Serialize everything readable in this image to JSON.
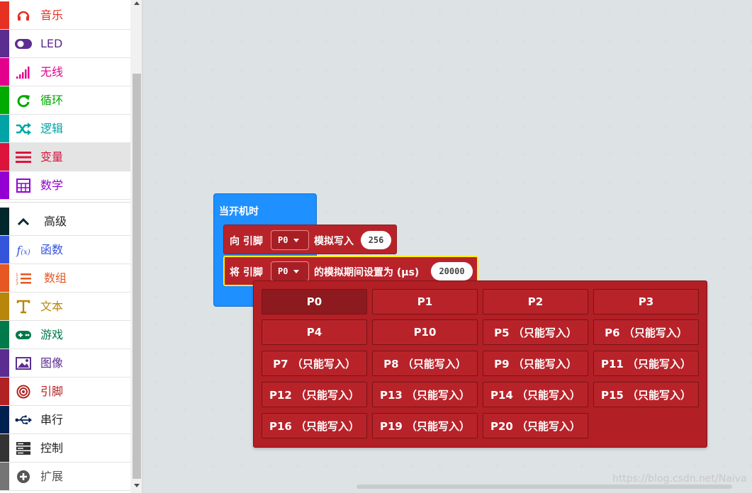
{
  "toolbox": {
    "categories_top": [
      {
        "label": "音乐",
        "icon": "headphones-icon",
        "color": "#e63022"
      },
      {
        "label": "LED",
        "icon": "toggle-icon",
        "color": "#5c2d91"
      },
      {
        "label": "无线",
        "icon": "signal-bars-icon",
        "color": "#e3008c"
      },
      {
        "label": "循环",
        "icon": "refresh-icon",
        "color": "#00aa00"
      },
      {
        "label": "逻辑",
        "icon": "shuffle-icon",
        "color": "#00a4a6"
      },
      {
        "label": "变量",
        "icon": "list-icon",
        "color": "#dc143c"
      },
      {
        "label": "数学",
        "icon": "calculator-icon",
        "color": "#9400d3"
      }
    ],
    "categories_bottom": [
      {
        "label": "高级",
        "icon": "chevron-up-icon",
        "color": "#00272b"
      },
      {
        "label": "函数",
        "icon": "function-icon",
        "color": "#3455db"
      },
      {
        "label": "数组",
        "icon": "numbered-list-icon",
        "color": "#e65722"
      },
      {
        "label": "文本",
        "icon": "text-icon",
        "color": "#b8860b"
      },
      {
        "label": "游戏",
        "icon": "gamepad-icon",
        "color": "#007a4b"
      },
      {
        "label": "图像",
        "icon": "image-icon",
        "color": "#5c2d91"
      },
      {
        "label": "引脚",
        "icon": "target-icon",
        "color": "#b22222"
      },
      {
        "label": "串行",
        "icon": "usb-icon",
        "color": "#002050"
      },
      {
        "label": "控制",
        "icon": "server-icon",
        "color": "#333333"
      },
      {
        "label": "扩展",
        "icon": "plus-circle-icon",
        "color": "#757575"
      }
    ]
  },
  "workspace": {
    "hat_block": {
      "label": "当开机时",
      "color": "#1e90ff"
    },
    "block_analog_write": {
      "prefix": "向 引脚",
      "pin": "P0",
      "suffix": "模拟写入",
      "value": "256"
    },
    "block_analog_period": {
      "prefix": "将 引脚",
      "pin": "P0",
      "suffix": "的模拟期间设置为 (μs)",
      "value": "20000"
    },
    "block_color": "#b8232a"
  },
  "dropdown": {
    "selected": "P0",
    "options": [
      "P0",
      "P1",
      "P2",
      "P3",
      "P4",
      "P10",
      "P5 （只能写入）",
      "P6 （只能写入）",
      "P7 （只能写入）",
      "P8 （只能写入）",
      "P9 （只能写入）",
      "P11 （只能写入）",
      "P12 （只能写入）",
      "P13 （只能写入）",
      "P14 （只能写入）",
      "P15 （只能写入）",
      "P16 （只能写入）",
      "P19 （只能写入）",
      "P20 （只能写入）"
    ]
  },
  "watermark": "https://blog.csdn.net/Naiva"
}
